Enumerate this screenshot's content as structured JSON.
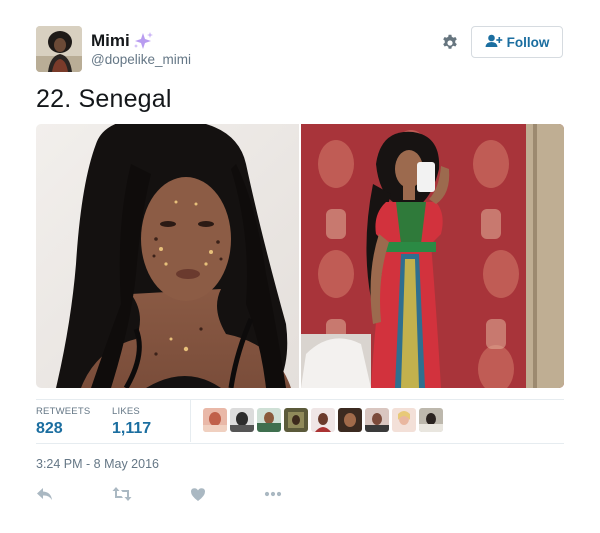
{
  "user": {
    "display_name": "Mimi",
    "handle": "@dopelike_mimi"
  },
  "header": {
    "follow_label": "Follow"
  },
  "tweet": {
    "text": "22. Senegal",
    "timestamp": "3:24 PM - 8 May 2016"
  },
  "stats": {
    "retweets_label": "RETWEETS",
    "retweets_value": "828",
    "likes_label": "LIKES",
    "likes_value": "1,117"
  },
  "colors": {
    "link_blue": "#1b6ea0",
    "muted": "#657786",
    "divider": "#e6ecf0",
    "sparkle": "#a98be0"
  },
  "icons": [
    "settings-gear-icon",
    "follow-person-icon",
    "reply-icon",
    "retweet-icon",
    "like-heart-icon",
    "more-dots-icon",
    "sparkles-emoji"
  ]
}
